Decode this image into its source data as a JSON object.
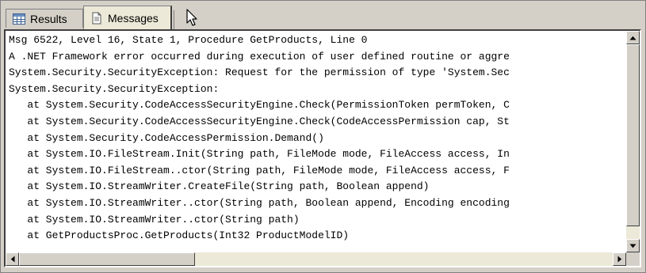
{
  "tabs": {
    "results_label": "Results",
    "messages_label": "Messages",
    "active": "Messages"
  },
  "messages": [
    "Msg 6522, Level 16, State 1, Procedure GetProducts, Line 0",
    "A .NET Framework error occurred during execution of user defined routine or aggre",
    "System.Security.SecurityException: Request for the permission of type 'System.Sec",
    "System.Security.SecurityException:",
    "   at System.Security.CodeAccessSecurityEngine.Check(PermissionToken permToken, C",
    "   at System.Security.CodeAccessSecurityEngine.Check(CodeAccessPermission cap, St",
    "   at System.Security.CodeAccessPermission.Demand()",
    "   at System.IO.FileStream.Init(String path, FileMode mode, FileAccess access, In",
    "   at System.IO.FileStream..ctor(String path, FileMode mode, FileAccess access, F",
    "   at System.IO.StreamWriter.CreateFile(String path, Boolean append)",
    "   at System.IO.StreamWriter..ctor(String path, Boolean append, Encoding encoding",
    "   at System.IO.StreamWriter..ctor(String path)",
    "   at GetProductsProc.GetProducts(Int32 ProductModelID)"
  ],
  "icons": {
    "results": "grid-icon",
    "messages": "document-icon",
    "cursor": "mouse-pointer-icon"
  }
}
